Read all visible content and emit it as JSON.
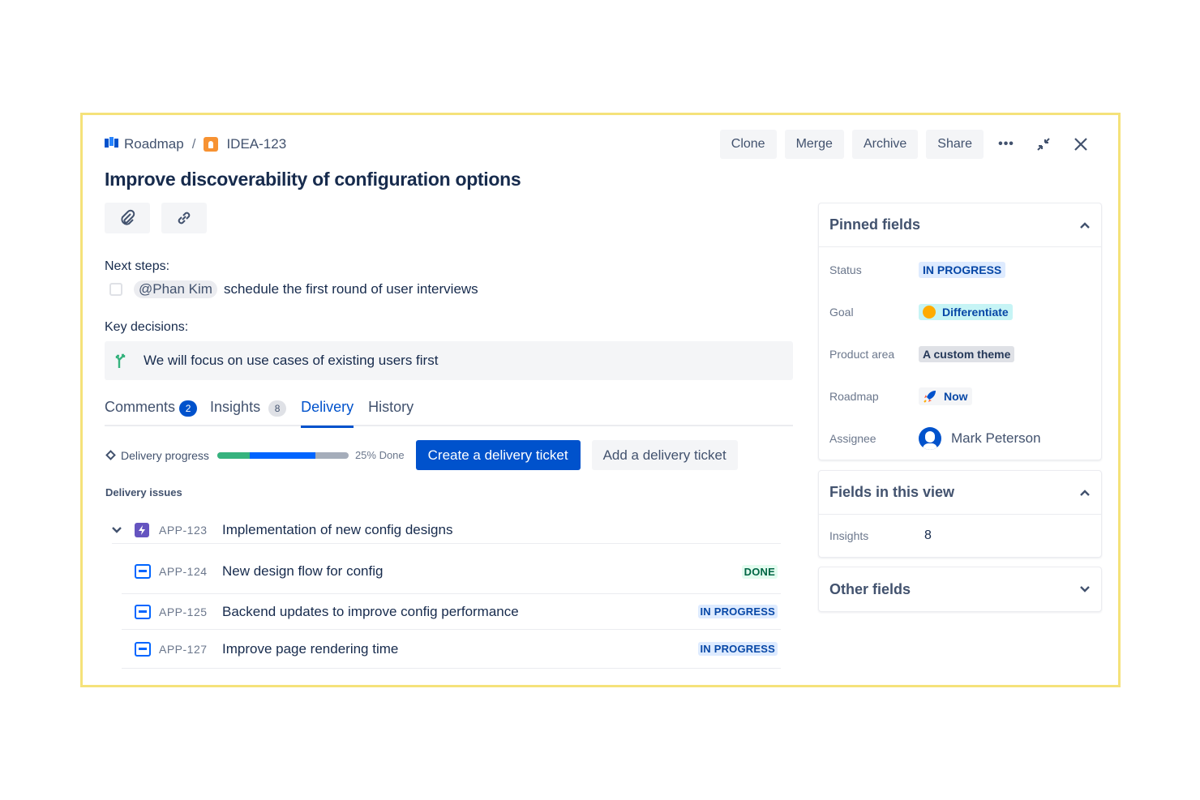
{
  "breadcrumb": {
    "project": "Roadmap",
    "separator": "/",
    "issue_key": "IDEA-123"
  },
  "actions": {
    "clone": "Clone",
    "merge": "Merge",
    "archive": "Archive",
    "share": "Share",
    "more": "•••"
  },
  "title": "Improve discoverability of configuration options",
  "icons": [
    "roadmap-icon",
    "idea-icon",
    "more-icon",
    "minimize-icon",
    "close-icon",
    "paperclip-icon",
    "link-icon",
    "decision-icon",
    "diamond-icon",
    "chevron-down-icon",
    "epic-icon",
    "task-icon",
    "goal-emoji-icon",
    "rocket-icon",
    "avatar-icon",
    "chevron-up-icon"
  ],
  "description": {
    "next_steps_label": "Next steps:",
    "task": {
      "mention": "@Phan Kim",
      "text": "schedule the first round of user interviews",
      "checked": false
    },
    "key_decisions_label": "Key decisions:",
    "decision": "We will focus on use cases of existing users first"
  },
  "tabs": [
    {
      "label": "Comments",
      "badge": "2",
      "active": false
    },
    {
      "label": "Insights",
      "badge": "8",
      "active": false
    },
    {
      "label": "Delivery",
      "badge": "",
      "active": true
    },
    {
      "label": "History",
      "badge": "",
      "active": false
    }
  ],
  "delivery": {
    "progress_label": "Delivery progress",
    "done_fraction": 0.25,
    "in_progress_fraction": 0.5,
    "progress_text": "25% Done",
    "create_button": "Create a delivery ticket",
    "add_button": "Add a delivery ticket",
    "issues_label": "Delivery issues",
    "parent": {
      "key": "APP-123",
      "summary": "Implementation of new config designs"
    },
    "issues": [
      {
        "key": "APP-124",
        "summary": "New design flow for config",
        "status": "DONE"
      },
      {
        "key": "APP-125",
        "summary": "Backend updates to improve config performance",
        "status": "IN PROGRESS"
      },
      {
        "key": "APP-127",
        "summary": "Improve page rendering time",
        "status": "IN PROGRESS"
      }
    ]
  },
  "pinned": {
    "title": "Pinned fields",
    "status_label": "Status",
    "status_value": "IN PROGRESS",
    "goal_label": "Goal",
    "goal_value": "Differentiate",
    "area_label": "Product area",
    "area_value": "A custom theme",
    "roadmap_label": "Roadmap",
    "roadmap_value": "Now",
    "assignee_label": "Assignee",
    "assignee_value": "Mark Peterson"
  },
  "view_fields": {
    "title": "Fields in this view",
    "insights_label": "Insights",
    "insights_value": "8"
  },
  "other_fields": {
    "title": "Other fields"
  },
  "colors": {
    "brand_blue": "#0052cc",
    "done_green": "#36b37e",
    "frame_yellow": "#f5e27a",
    "epic_purple": "#6554c0"
  }
}
